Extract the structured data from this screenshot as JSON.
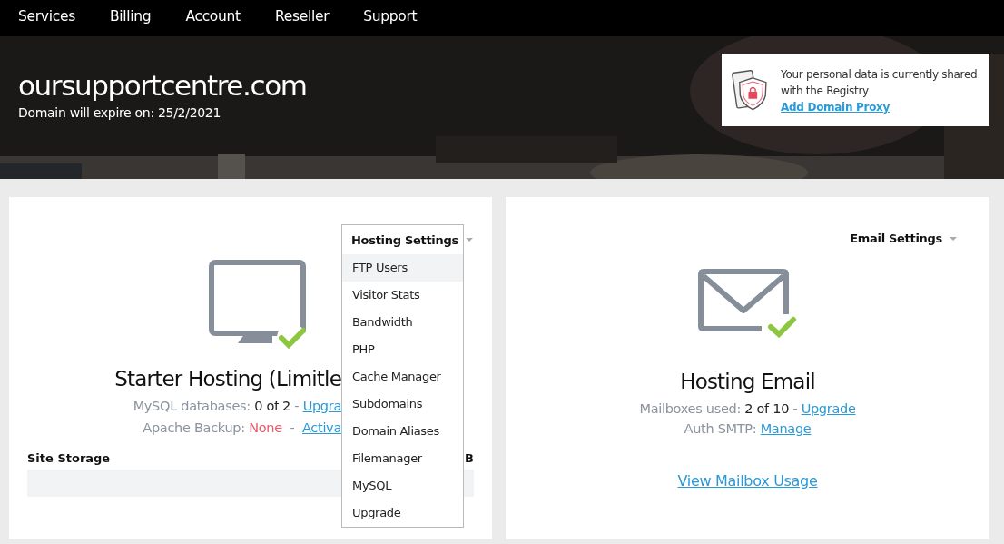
{
  "nav": [
    {
      "label": "Services"
    },
    {
      "label": "Billing"
    },
    {
      "label": "Account"
    },
    {
      "label": "Reseller"
    },
    {
      "label": "Support"
    }
  ],
  "domain": {
    "name": "oursupportcentre.com",
    "expiry": "Domain will expire on: 25/2/2021"
  },
  "privacy_notice": {
    "text": "Your personal data is currently shared with the Registry",
    "link": "Add Domain Proxy"
  },
  "hosting_card": {
    "settings_menu": {
      "label": "Hosting Settings",
      "expanded": true,
      "items": [
        {
          "label": "FTP Users",
          "selected": true
        },
        {
          "label": "Visitor Stats",
          "selected": false
        },
        {
          "label": "Bandwidth",
          "selected": false
        },
        {
          "label": "PHP",
          "selected": false
        },
        {
          "label": "Cache Manager",
          "selected": false
        },
        {
          "label": "Subdomains",
          "selected": false
        },
        {
          "label": "Domain Aliases",
          "selected": false
        },
        {
          "label": "Filemanager",
          "selected": false
        },
        {
          "label": "MySQL",
          "selected": false
        },
        {
          "label": "Upgrade",
          "selected": false
        }
      ]
    },
    "title": "Starter Hosting (Limitle",
    "lines": [
      {
        "kind": "count",
        "label": "MySQL databases:",
        "value": "0 of 2",
        "separator": "-",
        "link": "Upgra"
      },
      {
        "kind": "status",
        "label": "Apache Backup:",
        "value": "None",
        "separator": "-",
        "link": "Activa"
      }
    ],
    "storage": {
      "label": "Site Storage",
      "reading": "B"
    }
  },
  "email_card": {
    "settings_menu": {
      "label": "Email Settings",
      "expanded": false
    },
    "title": "Hosting Email",
    "lines": [
      {
        "kind": "count",
        "label": "Mailboxes used:",
        "value": "2 of 10",
        "separator": "-",
        "link": "Upgrade"
      },
      {
        "kind": "plain",
        "label": "Auth SMTP:",
        "link": "Manage"
      }
    ],
    "footer_link": "View Mailbox Usage"
  }
}
